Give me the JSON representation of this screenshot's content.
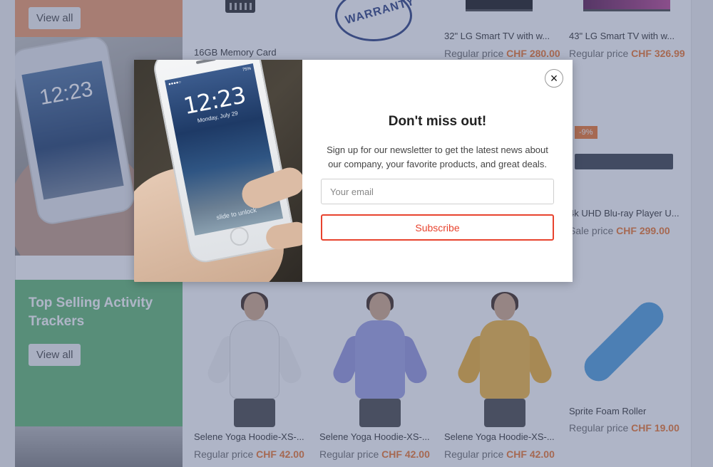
{
  "banners": {
    "top_button": "View all",
    "green_title": "Top Selling Activity Trackers",
    "green_button": "View all"
  },
  "phone_clock": "12:23",
  "products": [
    {
      "name": "16GB Memory Card",
      "price_label": "",
      "price": ""
    },
    {
      "name": "32\" LG Smart TV with w...",
      "price_label": "Regular price",
      "price": "CHF 280.00"
    },
    {
      "name": "43\" LG Smart TV with w...",
      "price_label": "Regular price",
      "price": "CHF 326.99"
    },
    {
      "name": "4k UHD Blu-ray Player U...",
      "price_label": "Sale price",
      "price": "CHF 299.00",
      "badge": "-9%"
    },
    {
      "name": "Selene Yoga Hoodie-XS-...",
      "price_label": "Regular price",
      "price": "CHF 42.00"
    },
    {
      "name": "Selene Yoga Hoodie-XS-...",
      "price_label": "Regular price",
      "price": "CHF 42.00"
    },
    {
      "name": "Selene Yoga Hoodie-XS-...",
      "price_label": "Regular price",
      "price": "CHF 42.00"
    },
    {
      "name": "Sprite Foam Roller",
      "price_label": "Regular price",
      "price": "CHF 19.00"
    }
  ],
  "warranty_stamp": "WARRANTY",
  "modal": {
    "close_symbol": "×",
    "title": "Don't miss out!",
    "description": "Sign up for our newsletter to get the latest news about our company, your favorite products, and great deals.",
    "email_placeholder": "Your email",
    "email_value": "",
    "subscribe_label": "Subscribe",
    "phone": {
      "time": "12:23",
      "date": "Monday, July 29",
      "carrier": "●●●●○",
      "battery": "75%",
      "slide_text": "slide to unlock"
    }
  },
  "colors": {
    "accent": "#e8432e",
    "price": "#f0803c",
    "overlay": "#364773",
    "banner_orange": "#f2a273",
    "banner_green": "#6fbf7d"
  }
}
